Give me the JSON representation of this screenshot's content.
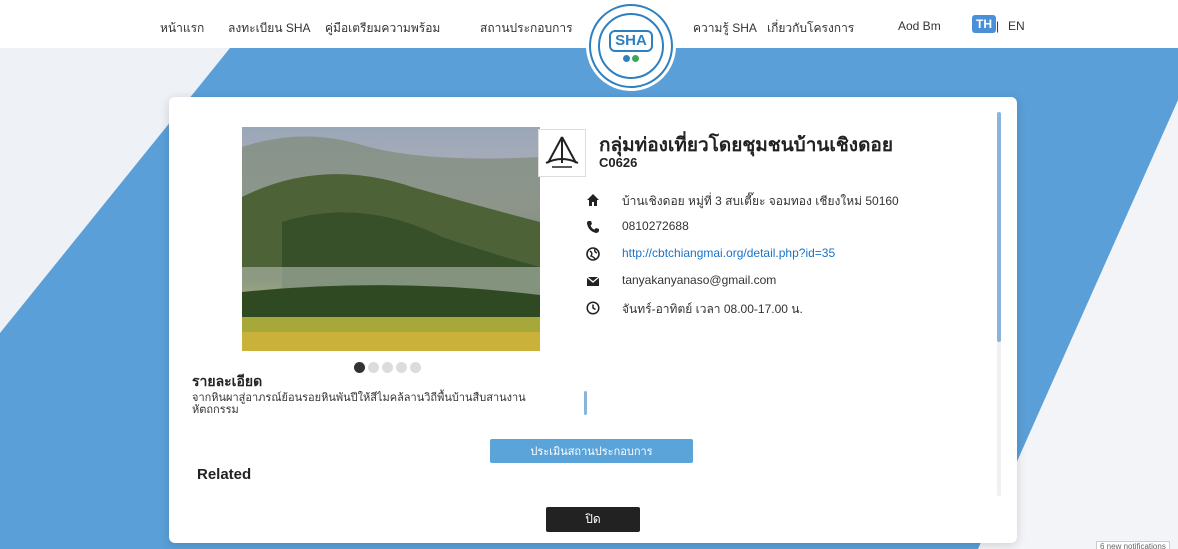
{
  "header": {
    "nav": [
      {
        "label": "หน้าแรก"
      },
      {
        "label": "ลงทะเบียน SHA"
      },
      {
        "label": "คู่มือเตรียมความพร้อม"
      },
      {
        "label": "สถานประกอบการ"
      },
      {
        "label": "ความรู้ SHA"
      },
      {
        "label": "เกี่ยวกับโครงการ"
      },
      {
        "label": "Aod Bm"
      }
    ],
    "lang": {
      "th": "TH",
      "separator": "|",
      "en": "EN"
    },
    "logo_text": "SHA"
  },
  "operator": {
    "title": "กลุ่มท่องเที่ยวโดยชุมชนบ้านเชิงดอย",
    "code": "C0626",
    "address": "บ้านเชิงดอย หมู่ที่ 3 สบเตี๊ยะ จอมทอง เชียงใหม่ 50160",
    "phone": "0810272688",
    "website": "http://cbtchiangmai.org/detail.php?id=35",
    "email": "tanyakanyanaso@gmail.com",
    "hours": "จันทร์-อาทิตย์ เวลา 08.00-17.00 น."
  },
  "gallery": {
    "count": 5,
    "active_index": 0
  },
  "detail": {
    "heading": "รายละเอียด",
    "text": "จากหินผาสู่อาภรณ์ย้อนรอยหินพันปีให้สีไมคล้ลานวิถีพื้นบ้านสืบสานงานหัตถกรรม"
  },
  "buttons": {
    "assess": "ประเมินสถานประกอบการ",
    "close": "ปิด"
  },
  "related_heading": "Related",
  "notification": "6 new notifications",
  "colors": {
    "accent": "#5ba4da",
    "link": "#1a73c9",
    "background_blue": "#5a9fd8"
  }
}
